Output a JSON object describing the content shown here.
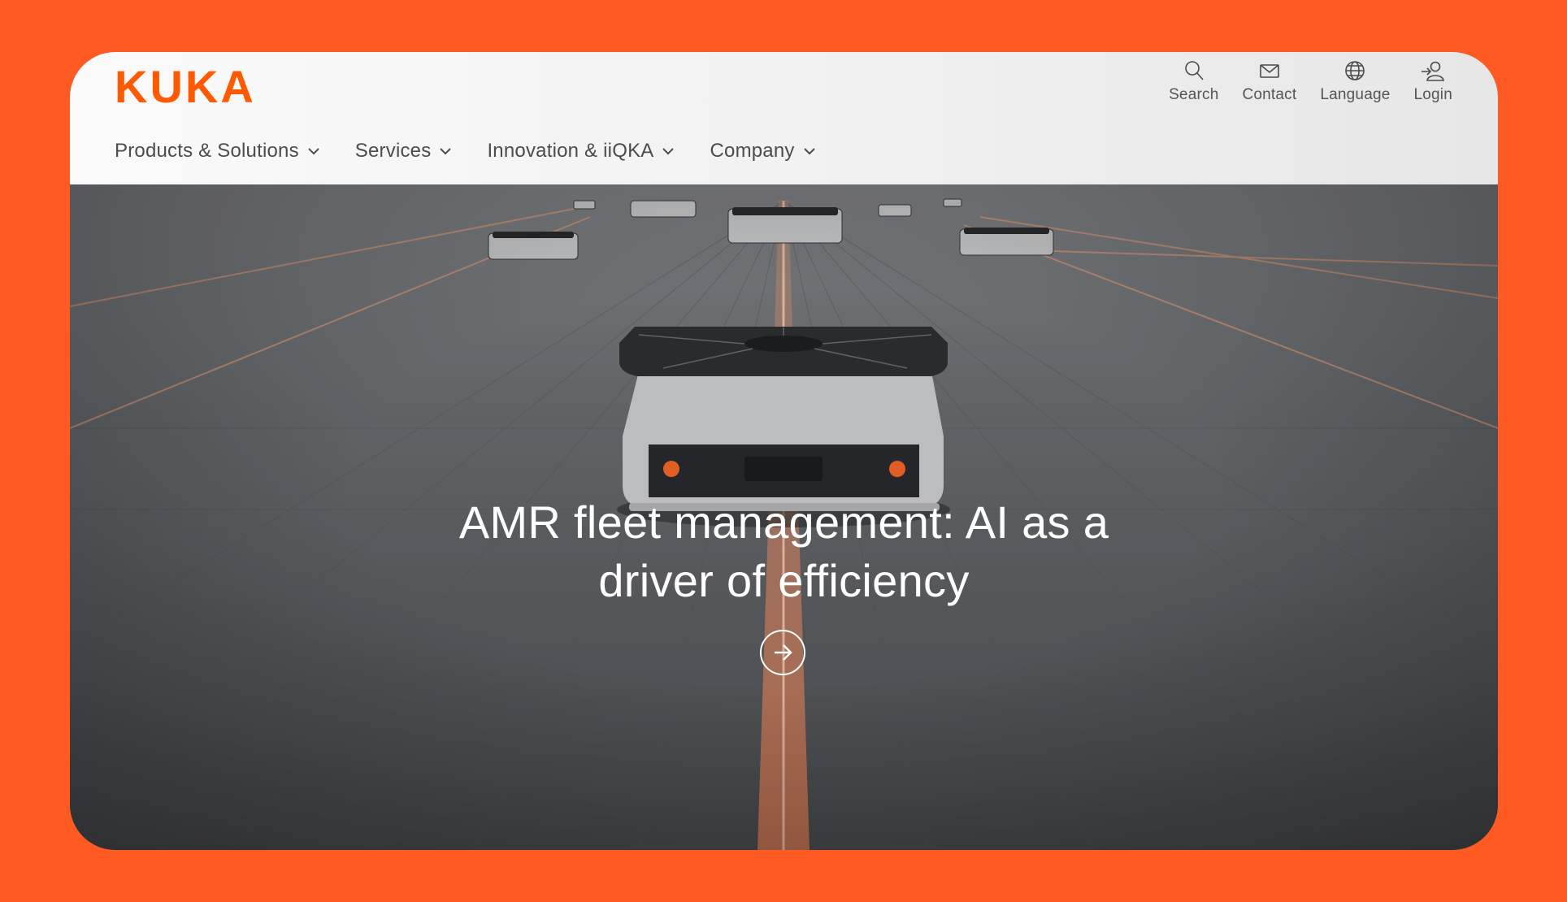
{
  "brand": {
    "name": "KUKA",
    "color": "#FF5A00"
  },
  "utility_nav": [
    {
      "label": "Search",
      "icon": "search-icon"
    },
    {
      "label": "Contact",
      "icon": "mail-icon"
    },
    {
      "label": "Language",
      "icon": "globe-icon"
    },
    {
      "label": "Login",
      "icon": "login-icon"
    }
  ],
  "main_nav": [
    {
      "label": "Products & Solutions",
      "icon": "chevron-down-icon"
    },
    {
      "label": "Services",
      "icon": "chevron-down-icon"
    },
    {
      "label": "Innovation & iiQKA",
      "icon": "chevron-down-icon"
    },
    {
      "label": "Company",
      "icon": "chevron-down-icon"
    }
  ],
  "hero": {
    "headline_line1": "AMR fleet management: AI as a",
    "headline_line2": "driver of efficiency",
    "cta_icon": "arrow-right-icon"
  },
  "colors": {
    "background": "#FF5A22",
    "accent": "#FF5A00",
    "hero_overlay": "#5d6064"
  }
}
